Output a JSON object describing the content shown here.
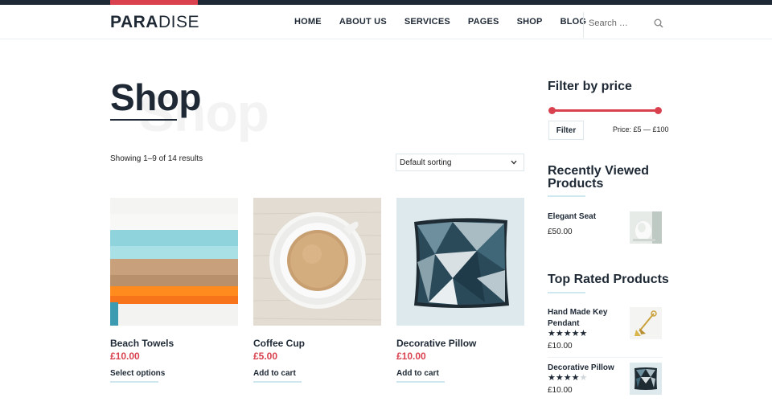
{
  "header": {
    "logo_bold": "PARA",
    "logo_light": "DISE",
    "nav": [
      "HOME",
      "ABOUT US",
      "SERVICES",
      "PAGES",
      "SHOP",
      "BLOG"
    ],
    "search_placeholder": "Search …",
    "accent_color": "#d9414f",
    "dark_color": "#1e2935"
  },
  "page": {
    "title": "Shop",
    "ghost_title": "Shop",
    "result_count": "Showing 1–9 of 14 results",
    "sort_selected": "Default sorting"
  },
  "products": [
    {
      "name": "Beach Towels",
      "price": "£10.00",
      "action": "Select options"
    },
    {
      "name": "Coffee Cup",
      "price": "£5.00",
      "action": "Add to cart"
    },
    {
      "name": "Decorative Pillow",
      "price": "£10.00",
      "action": "Add to cart"
    }
  ],
  "sidebar": {
    "filter_title": "Filter by price",
    "filter_button": "Filter",
    "price_range": "Price: £5 — £100",
    "price_min_fraction": 0,
    "price_max_fraction": 1,
    "recent_title": "Recently Viewed Products",
    "recent_items": [
      {
        "name": "Elegant Seat",
        "price": "£50.00"
      }
    ],
    "top_title": "Top Rated Products",
    "top_items": [
      {
        "name": "Hand Made Key Pendant",
        "price": "£10.00",
        "rating": 5
      },
      {
        "name": "Decorative Pillow",
        "price": "£10.00",
        "rating": 4
      }
    ]
  }
}
